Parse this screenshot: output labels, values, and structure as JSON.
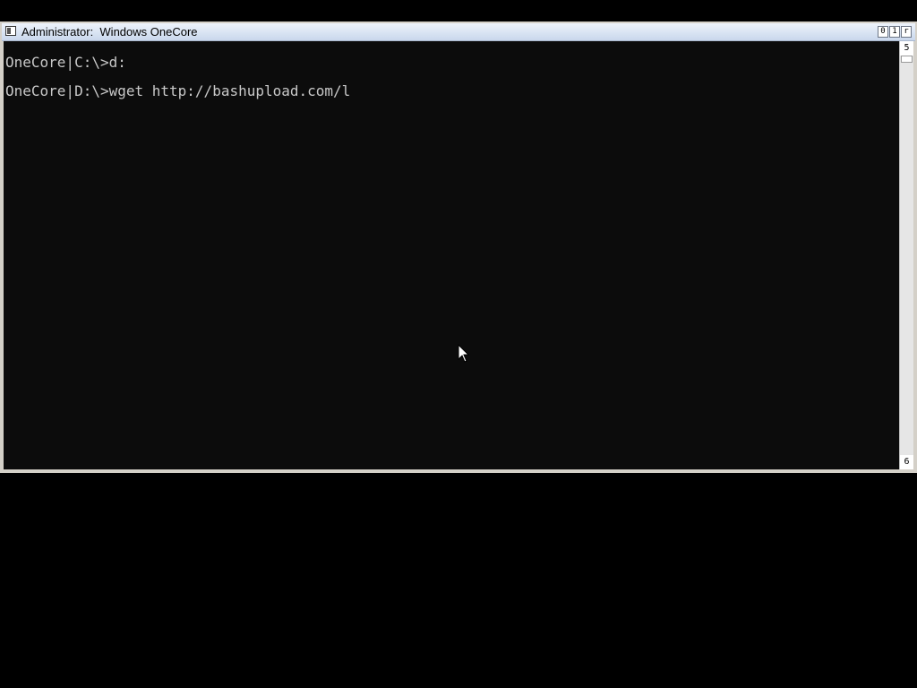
{
  "window": {
    "title": "Administrator:  Windows OneCore",
    "buttons": {
      "minimize": "0",
      "maximize": "1",
      "close": "r"
    }
  },
  "console": {
    "lines": [
      "OneCore|C:\\>d:",
      "OneCore|D:\\>wget http://bashupload.com/l"
    ]
  },
  "scrollbar": {
    "up_arrow": "5",
    "down_arrow": "6"
  },
  "icons": {
    "window_icon": "console-window-icon",
    "pointer": "mouse-pointer-icon"
  }
}
